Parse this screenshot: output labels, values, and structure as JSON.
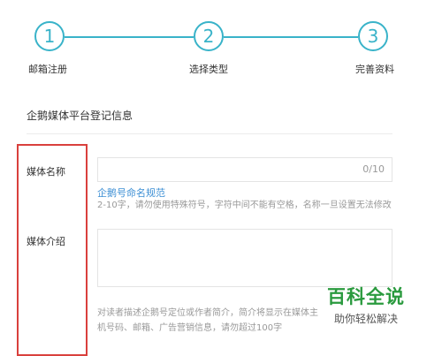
{
  "steps": [
    {
      "number": "1",
      "label": "邮箱注册"
    },
    {
      "number": "2",
      "label": "选择类型"
    },
    {
      "number": "3",
      "label": "完善资料"
    }
  ],
  "form": {
    "section_title": "企鹅媒体平台登记信息",
    "media_name": {
      "label": "媒体名称",
      "value": "",
      "counter": "0/10",
      "rules_link": "企鹅号命名规范",
      "hint": "2-10字，请勿使用特殊符号，字符中间不能有空格，名称一旦设置无法修改"
    },
    "media_intro": {
      "label": "媒体介绍",
      "value": "",
      "hint_line1": "对读者描述企鹅号定位或作者简介，简介将显示在媒体主",
      "hint_line2": "机号码、邮箱、广告营销信息，请勿超过100字"
    }
  },
  "watermark": {
    "main": "百科全说",
    "sub": "助你轻松解决"
  },
  "colors": {
    "accent": "#39b3c9",
    "link": "#3d8fd4",
    "highlight_box": "#d9403d",
    "watermark": "#2a9a3e"
  }
}
